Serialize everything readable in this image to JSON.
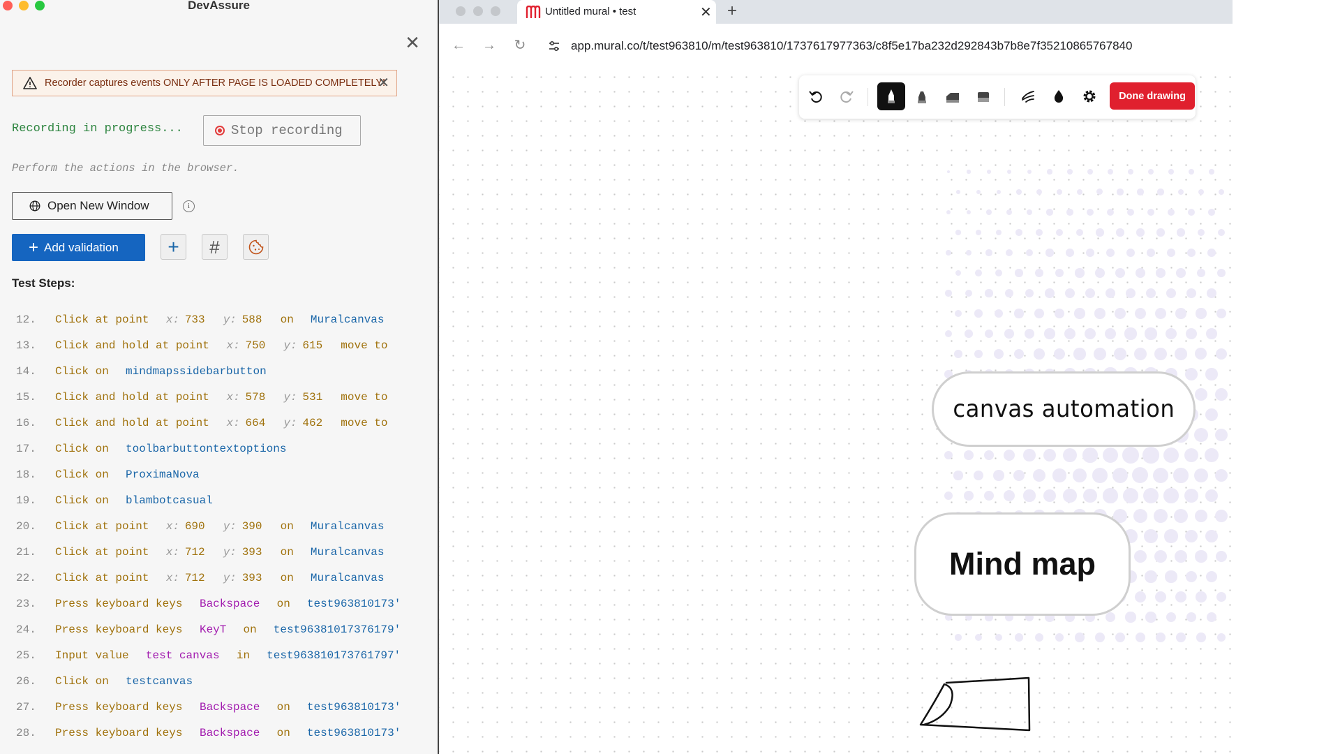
{
  "devassure": {
    "title": "DevAssure",
    "warning": "Recorder captures events ONLY AFTER PAGE IS LOADED COMPLETELY!",
    "recording_status": "Recording in progress...",
    "stop_button": "Stop recording",
    "hint": "Perform the actions in the browser.",
    "open_window_button": "Open New Window",
    "info_glyph": "i",
    "add_validation_button": "Add validation",
    "add_validation_glyph": "+",
    "tools": {
      "plus": "+",
      "hash": "#"
    },
    "test_steps_label": "Test Steps:",
    "close_glyph": "✕",
    "steps": [
      {
        "num": "12.",
        "action": "Click at point",
        "x_label": "x:",
        "x": "733",
        "y_label": "y:",
        "y": "588",
        "on": "on",
        "target": "Muralcanvas"
      },
      {
        "num": "13.",
        "action": "Click and hold at point",
        "x_label": "x:",
        "x": "750",
        "y_label": "y:",
        "y": "615",
        "suffix": "move to"
      },
      {
        "num": "14.",
        "action": "Click on",
        "target": "mindmapssidebarbutton"
      },
      {
        "num": "15.",
        "action": "Click and hold at point",
        "x_label": "x:",
        "x": "578",
        "y_label": "y:",
        "y": "531",
        "suffix": "move to"
      },
      {
        "num": "16.",
        "action": "Click and hold at point",
        "x_label": "x:",
        "x": "664",
        "y_label": "y:",
        "y": "462",
        "suffix": "move to"
      },
      {
        "num": "17.",
        "action": "Click on",
        "target": "toolbarbuttontextoptions"
      },
      {
        "num": "18.",
        "action": "Click on",
        "target": "ProximaNova"
      },
      {
        "num": "19.",
        "action": "Click on",
        "target": "blambotcasual"
      },
      {
        "num": "20.",
        "action": "Click at point",
        "x_label": "x:",
        "x": "690",
        "y_label": "y:",
        "y": "390",
        "on": "on",
        "target": "Muralcanvas"
      },
      {
        "num": "21.",
        "action": "Click at point",
        "x_label": "x:",
        "x": "712",
        "y_label": "y:",
        "y": "393",
        "on": "on",
        "target": "Muralcanvas"
      },
      {
        "num": "22.",
        "action": "Click at point",
        "x_label": "x:",
        "x": "712",
        "y_label": "y:",
        "y": "393",
        "on": "on",
        "target": "Muralcanvas"
      },
      {
        "num": "23.",
        "action": "Press keyboard keys",
        "key": "Backspace",
        "on": "on",
        "target": "test963810173'"
      },
      {
        "num": "24.",
        "action": "Press keyboard keys",
        "key": "KeyT",
        "on": "on",
        "target": "test96381017376179'"
      },
      {
        "num": "25.",
        "action": "Input value",
        "value": "test canvas",
        "on": "in",
        "target": "test963810173761797'"
      },
      {
        "num": "26.",
        "action": "Click on",
        "target": "testcanvas"
      },
      {
        "num": "27.",
        "action": "Press keyboard keys",
        "key": "Backspace",
        "on": "on",
        "target": "test963810173'"
      },
      {
        "num": "28.",
        "action": "Press keyboard keys",
        "key": "Backspace",
        "on": "on",
        "target": "test963810173'"
      }
    ]
  },
  "browser": {
    "tab_title": "Untitled mural • test",
    "tab_close": "✕",
    "new_tab": "+",
    "url": "app.mural.co/t/test963810/m/test963810/1737617977363/c8f5e17ba232d292843b7b8e7f35210865767840",
    "nav": {
      "back": "←",
      "forward": "→",
      "reload": "↻"
    }
  },
  "mural": {
    "toolbar": {
      "done_button": "Done drawing",
      "icons": [
        "undo-icon",
        "redo-icon",
        "marker-pen-icon",
        "highlighter-pen-icon",
        "chisel-pen-icon",
        "eraser-icon",
        "smoothing-icon",
        "color-drop-icon",
        "settings-gear-icon"
      ]
    },
    "nodes": {
      "canvas_automation": "canvas automation",
      "mind_map": "Mind map"
    },
    "colors": {
      "done_button": "#e0202e",
      "brand": "#e0202e",
      "node_border": "#cfcfcf",
      "halftone": "#ece9f7"
    }
  },
  "colors": {
    "add_validation": "#1565c0",
    "recording_green": "#2e8540",
    "warning_border": "#e0a487"
  }
}
